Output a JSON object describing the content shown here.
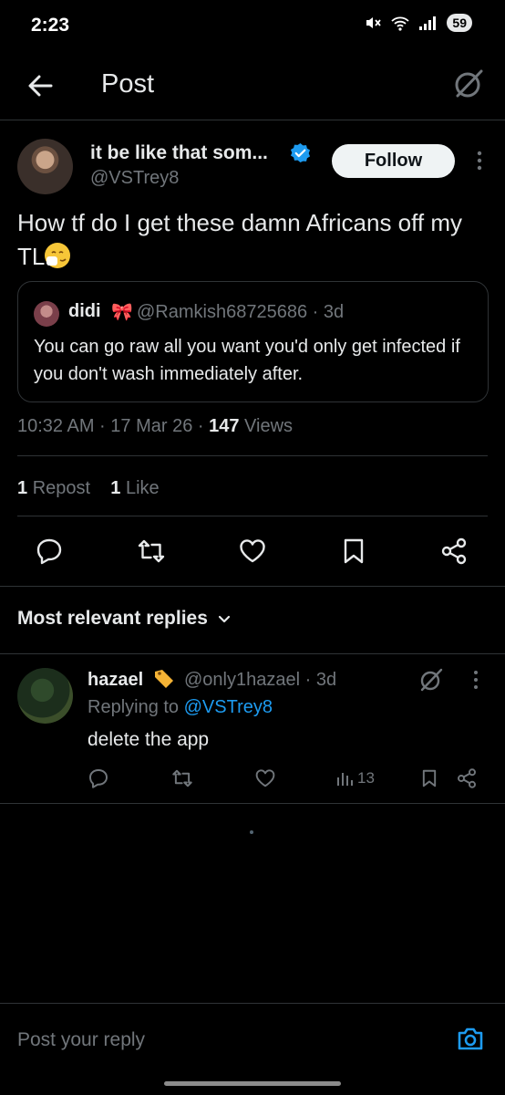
{
  "status_bar": {
    "time": "2:23",
    "battery": "59"
  },
  "header": {
    "title": "Post"
  },
  "post": {
    "author_name": "it be like that som...",
    "author_handle": "@VSTrey8",
    "follow_label": "Follow",
    "text_main": "How tf do I get these damn Africans off my TL",
    "emoji": "sneezing-face",
    "quote": {
      "name": "didi",
      "emoji": "🎀",
      "meta": "@Ramkish68725686 · 3d",
      "text": "You can go raw all you want you'd only get infected if you don't wash immediately after."
    },
    "time": "10:32 AM · 17 Mar 26 · ",
    "views_count": "147",
    "views_label": " Views",
    "reposts_count": "1",
    "reposts_label": "Repost",
    "likes_count": "1",
    "likes_label": "Like"
  },
  "replies": {
    "sort_label": "Most relevant replies",
    "items": [
      {
        "name": "hazael",
        "meta": "@only1hazael · 3d",
        "replying_prefix": "Replying to ",
        "replying_handle": "@VSTrey8",
        "text": "delete the app",
        "views": "13"
      }
    ]
  },
  "composer": {
    "placeholder": "Post your reply"
  },
  "colors": {
    "background": "#000000",
    "text": "#e7e9ea",
    "muted": "#71767b",
    "accent": "#1d9bf0",
    "divider": "#2f3336"
  }
}
